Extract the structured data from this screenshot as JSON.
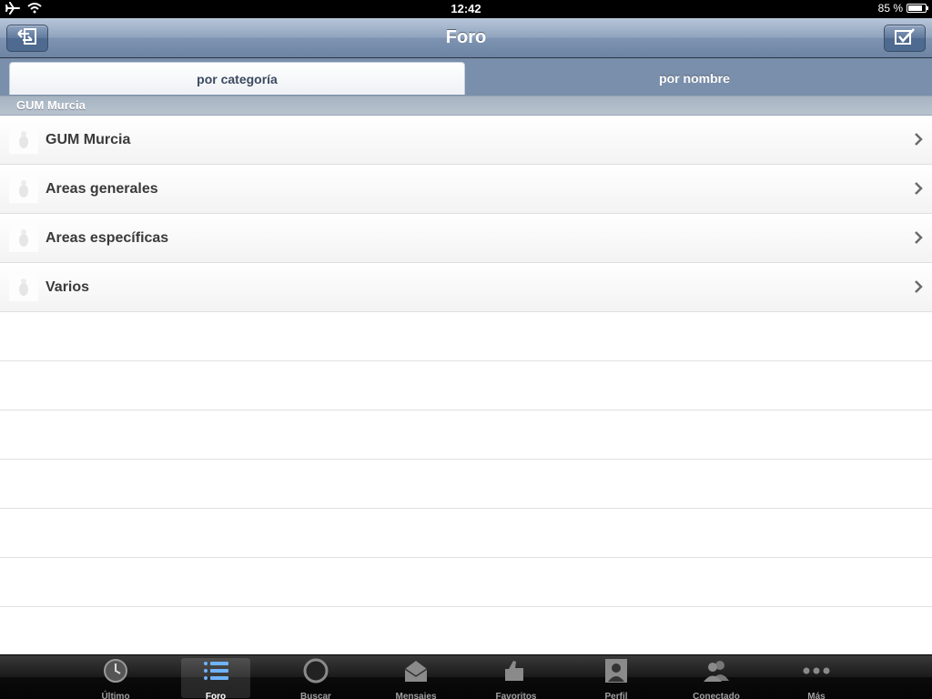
{
  "status_bar": {
    "time": "12:42",
    "battery": "85 %",
    "battery_level": 0.85
  },
  "nav": {
    "title": "Foro",
    "left_button_icon": "back-arrows-icon",
    "right_button_icon": "checkmark-icon"
  },
  "segments": [
    {
      "label": "por categoría",
      "selected": true
    },
    {
      "label": "por nombre",
      "selected": false
    }
  ],
  "section": {
    "header": "GUM Murcia",
    "items": [
      {
        "label": "GUM Murcia",
        "icon": "forum-thumb-icon"
      },
      {
        "label": "Areas generales",
        "icon": "forum-thumb-icon"
      },
      {
        "label": "Areas específicas",
        "icon": "forum-thumb-icon"
      },
      {
        "label": "Varios",
        "icon": "forum-thumb-icon"
      }
    ]
  },
  "tabs": [
    {
      "label": "Último",
      "icon": "clock-icon"
    },
    {
      "label": "Foro",
      "icon": "list-icon",
      "selected": true
    },
    {
      "label": "Buscar",
      "icon": "search-icon"
    },
    {
      "label": "Mensajes",
      "icon": "envelope-icon"
    },
    {
      "label": "Favoritos",
      "icon": "thumbs-up-icon"
    },
    {
      "label": "Perfil",
      "icon": "profile-icon"
    },
    {
      "label": "Conectado",
      "icon": "users-icon"
    },
    {
      "label": "Más",
      "icon": "more-icon"
    }
  ],
  "colors": {
    "nav_bar": "#7e94b2",
    "tab_selected": "#6fb3ff"
  }
}
